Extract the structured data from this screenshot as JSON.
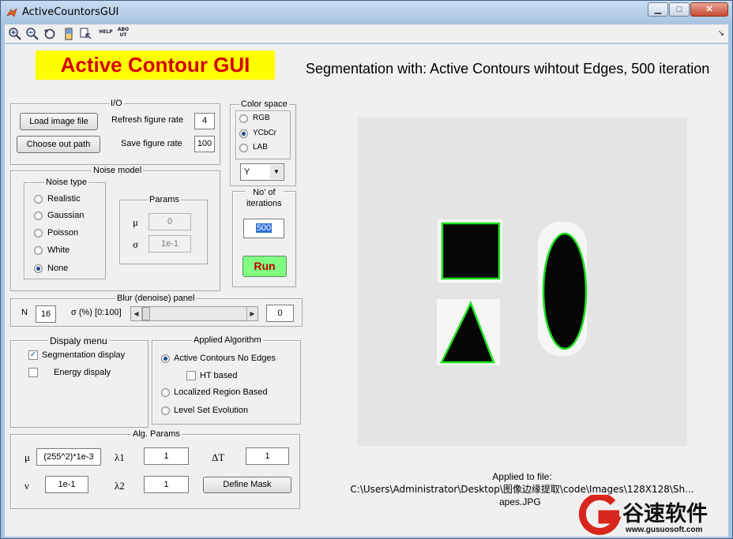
{
  "window": {
    "title": "ActiveCountorsGUI",
    "min": "▁",
    "max": "□",
    "close": "✕"
  },
  "toolbar": {
    "help": "HELP",
    "about_top": "ABO",
    "about_bottom": "UT",
    "dock": "↘"
  },
  "header": {
    "gui_title": "Active Contour GUI",
    "segmentation_title": "Segmentation with: Active Contours wihtout Edges, 500 iteration"
  },
  "io": {
    "title": "I/O",
    "load_btn": "Load image file",
    "out_btn": "Choose out path",
    "refresh_label": "Refresh figure rate",
    "refresh_value": "4",
    "save_label": "Save figure rate",
    "save_value": "100"
  },
  "color_space": {
    "title": "Color space",
    "options": [
      "RGB",
      "YCbCr",
      "LAB"
    ],
    "selected": "YCbCr",
    "channel": "Y"
  },
  "noise": {
    "title": "Noise model",
    "type_title": "Noise type",
    "types": [
      "Realistic",
      "Gaussian",
      "Poisson",
      "White",
      "None"
    ],
    "selected": "None",
    "params_title": "Params",
    "mu_sym": "μ",
    "mu_value": "0",
    "sigma_sym": "σ",
    "sigma_value": "1e-1"
  },
  "iterations": {
    "title_line1": "No' of",
    "title_line2": "iterations",
    "value": "500",
    "run": "Run"
  },
  "blur": {
    "title": "Blur (denoise) panel",
    "n_label": "N",
    "n_value": "16",
    "sigma_label": "σ (%) [0:100]",
    "sigma_value": "0",
    "slider_fraction": 0.0
  },
  "display": {
    "title": "Dispaly menu",
    "seg_label": "Segmentation display",
    "seg_checked": true,
    "energy_label": "Energy dispaly",
    "energy_checked": false
  },
  "algorithm": {
    "title": "Applied Algorithm",
    "options": [
      "Active Contours No Edges",
      "Localized Region Based",
      "Level Set Evolution"
    ],
    "selected": "Active Contours No Edges",
    "ht_label": "HT based"
  },
  "alg_params": {
    "title": "Alg. Params",
    "mu_sym": "μ",
    "mu_value": "(255^2)*1e-3",
    "lambda1_sym": "λ1",
    "lambda1_value": "1",
    "dt_sym": "ΔT",
    "dt_value": "1",
    "nu_sym": "ν",
    "nu_value": "1e-1",
    "lambda2_sym": "λ2",
    "lambda2_value": "1",
    "define_mask": "Define Mask"
  },
  "file": {
    "line1": "Applied to file:",
    "line2": "C:\\Users\\Administrator\\Desktop\\图像边缘提取\\code\\Images\\128X128\\Sh...",
    "line3": "apes.JPG"
  },
  "watermark": {
    "brand": "谷速软件",
    "url": "www.gusuosoft.com",
    "accent": "#d8261c"
  },
  "colors": {
    "gui_title_bg": "#ffff00",
    "gui_title_fg": "#d40000",
    "run_bg": "#80ff80",
    "run_fg": "#c00000",
    "contour": "#1ee01e"
  }
}
